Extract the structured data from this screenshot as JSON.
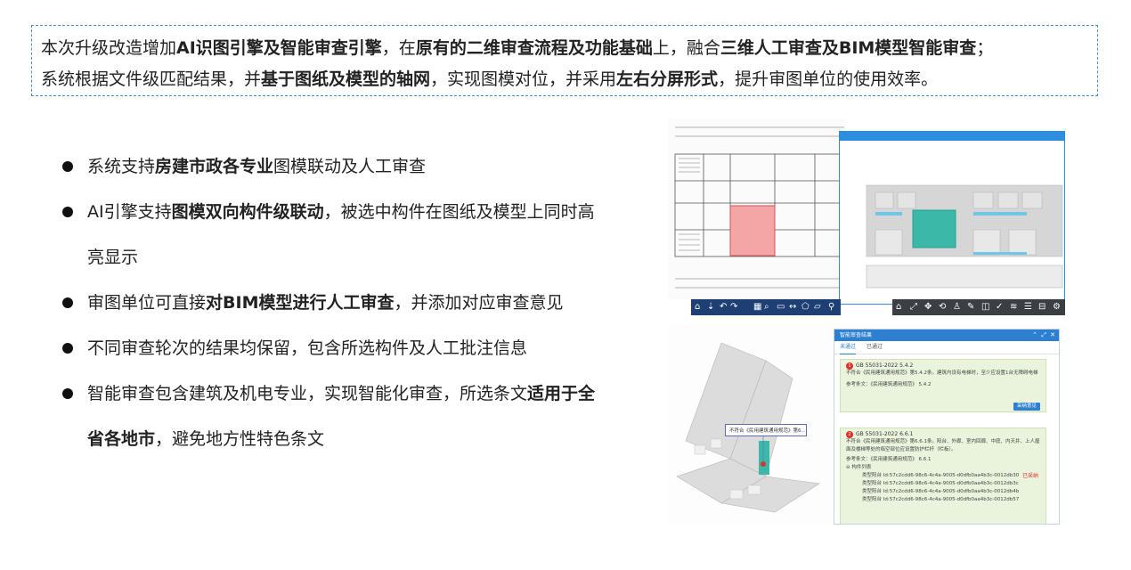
{
  "intro": {
    "l1a": "本次升级改造增加",
    "l1b": "AI识图引擎及智能审查引擎",
    "l1c": "，在",
    "l1d": "原有的二维审查流程及功能基础",
    "l1e": "上，融合",
    "l1f": "三维人工审查及BIM模型智能审查",
    "l1g": "；",
    "l2a": "系统根据文件级匹配结果，并",
    "l2b": "基于图纸及模型的轴网",
    "l2c": "，实现图模对位，并采用",
    "l2d": "左右分屏形式",
    "l2e": "，提升审图单位的使用效率。"
  },
  "bullets": [
    {
      "a": "系统支持",
      "b": "房建市政各专业",
      "c": "图模联动及人工审查"
    },
    {
      "a": "AI引擎支持",
      "b": "图模双向构件级联动",
      "c": "，被选中构件在图纸及模型上同时高亮显示"
    },
    {
      "a": "审图单位可直接",
      "b": "对BIM模型进行人工审查",
      "c": "，并添加对应审查意见"
    },
    {
      "a": "不同审查轮次的结果均保留，包含所选构件及人工批注信息",
      "b": "",
      "c": ""
    },
    {
      "a": "智能审查包含建筑及机电专业，实现智能化审查，所选条文",
      "b": "适用于全省各地市",
      "c": "，避免地方性特色条文"
    }
  ],
  "panel": {
    "title": "智能审查结果",
    "tabs": [
      "未通过",
      "已通过"
    ],
    "issue1": {
      "num": "1",
      "code": "GB 55031-2022 5.4.2",
      "text": "不符合《民用建筑通用规范》第5.4.2条。建筑内设有电梯时，至少应设置1台无障碍电梯",
      "ref": "参考条文：《民用建筑通用规范》 5.4.2",
      "button": "采纳意见"
    },
    "issue2": {
      "num": "2",
      "code": "GB 55031-2022 6.6.1",
      "text": "不符合《民用建筑通用规范》第6.6.1条。阳台、外廊、室内回廊、中庭、内天井、上人屋面及楼梯等处的临空部位应设置防护栏杆（栏板）。",
      "ref": "参考条文：《民用建筑通用规范》 6.6.1",
      "status": "已采纳",
      "list_label": "构件列表",
      "components": [
        "类型阳台 Id:57c2cdd6-98c6-4c4a-9005-d0dfb0aa4b3c-0012db30",
        "类型阳台 Id:57c2cdd6-98c6-4c4a-9005-d0dfb0aa4b3c-0012db3c",
        "类型阳台 Id:57c2cdd6-98c6-4c4a-9005-d0dfb0aa4b3c-0012db4b",
        "类型阳台 Id:57c2cdd6-98c6-4c4a-9005-d0dfb0aa4b3c-0012db57"
      ]
    }
  },
  "popup_text": "不符合《民用建筑通用规范》第6...",
  "colors": {
    "accent": "#2d7fd0",
    "highlight": "#f4a6a6",
    "model_highlight": "#3cb8a8"
  }
}
